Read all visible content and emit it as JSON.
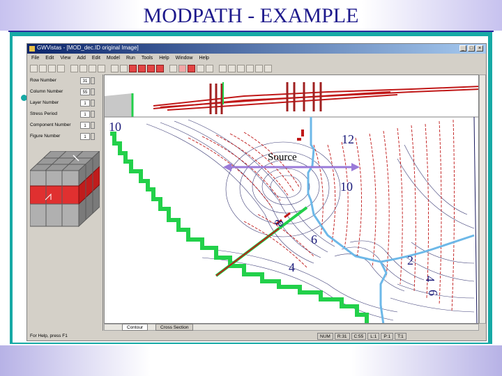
{
  "slide": {
    "title": "MODPATH - EXAMPLE"
  },
  "window": {
    "title": "GWVistas - [MOD_dec.ID original Image]"
  },
  "menu": [
    "File",
    "Edit",
    "View",
    "Add",
    "Edit",
    "Model",
    "Run",
    "Tools",
    "Help",
    "Window",
    "Help"
  ],
  "panel": {
    "fields": [
      {
        "label": "Row Number",
        "value": "31"
      },
      {
        "label": "Column Number",
        "value": "55"
      },
      {
        "label": "Layer Number",
        "value": "1"
      },
      {
        "label": "Stress Period",
        "value": "1"
      },
      {
        "label": "Component Number",
        "value": "1"
      },
      {
        "label": "Figure Number",
        "value": "1"
      }
    ]
  },
  "map": {
    "contour_labels": [
      "10",
      "12",
      "10",
      "8",
      "6",
      "4",
      "2",
      "4",
      "6"
    ],
    "annotation": "Source"
  },
  "tabs": [
    "Contour",
    "Cross Section"
  ],
  "status": [
    "For Help, press F1",
    "NUM",
    "R:31",
    "C:55",
    "L:1",
    "P:1",
    "T:1"
  ],
  "colors": {
    "slide_title": "#1e1a8c",
    "frame": "#16a9a5",
    "contour_red": "#c01818",
    "contour_dark": "#1a1a5e",
    "boundary_green": "#22d04a",
    "river_blue": "#6db8e8",
    "arrow_purple": "#9a7ad8"
  },
  "icons": [
    "app-icon",
    "minimize-icon",
    "maximize-icon",
    "close-icon",
    "grid-cube-icon"
  ]
}
